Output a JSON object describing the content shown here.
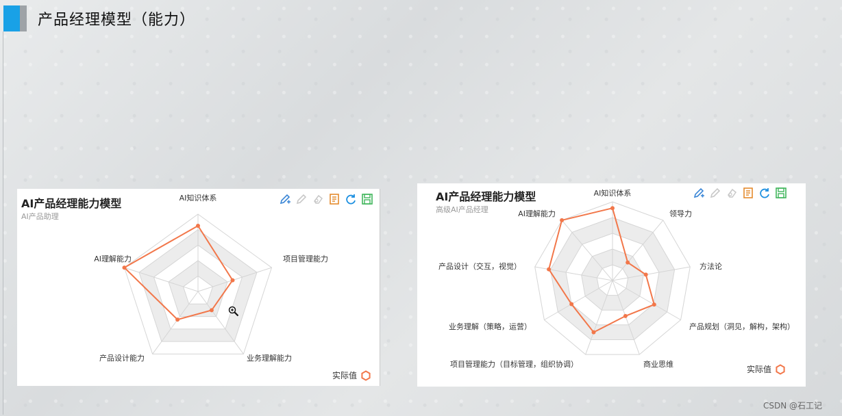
{
  "page": {
    "title": "产品经理模型（能力）",
    "watermark": "CSDN @石工记"
  },
  "colors": {
    "accent_blue": "#19a1e6",
    "series": "#f2774a",
    "grid": "#d5d5d5",
    "band": "#ececec"
  },
  "icons": [
    "pencil-add-icon",
    "pencil-icon",
    "eraser-icon",
    "document-icon",
    "refresh-icon",
    "save-icon"
  ],
  "chart_data": [
    {
      "type": "radar",
      "title": "AI产品经理能力模型",
      "subtitle": "AI产品助理",
      "categories": [
        "AI知识体系",
        "项目管理能力",
        "业务理解能力",
        "产品设计能力",
        "AI理解能力"
      ],
      "max": 1,
      "series": [
        {
          "name": "实际值",
          "values": [
            0.85,
            0.47,
            0.3,
            0.45,
            1.0
          ]
        }
      ],
      "grid_levels": 5,
      "legend": "bottom-right"
    },
    {
      "type": "radar",
      "title": "AI产品经理能力模型",
      "subtitle": "高级AI产品经理",
      "categories": [
        "AI知识体系",
        "领导力",
        "方法论",
        "产品规划（洞见，解构，架构）",
        "商业思维",
        "项目管理能力（目标管理，组织协调）",
        "业务理解（策略，运营）",
        "产品设计（交互，视觉）",
        "AI理解能力"
      ],
      "max": 1,
      "series": [
        {
          "name": "实际值",
          "values": [
            0.92,
            0.3,
            0.43,
            0.61,
            0.48,
            0.7,
            0.6,
            0.82,
            1.0
          ]
        }
      ],
      "grid_levels": 5,
      "legend": "bottom-right"
    }
  ]
}
